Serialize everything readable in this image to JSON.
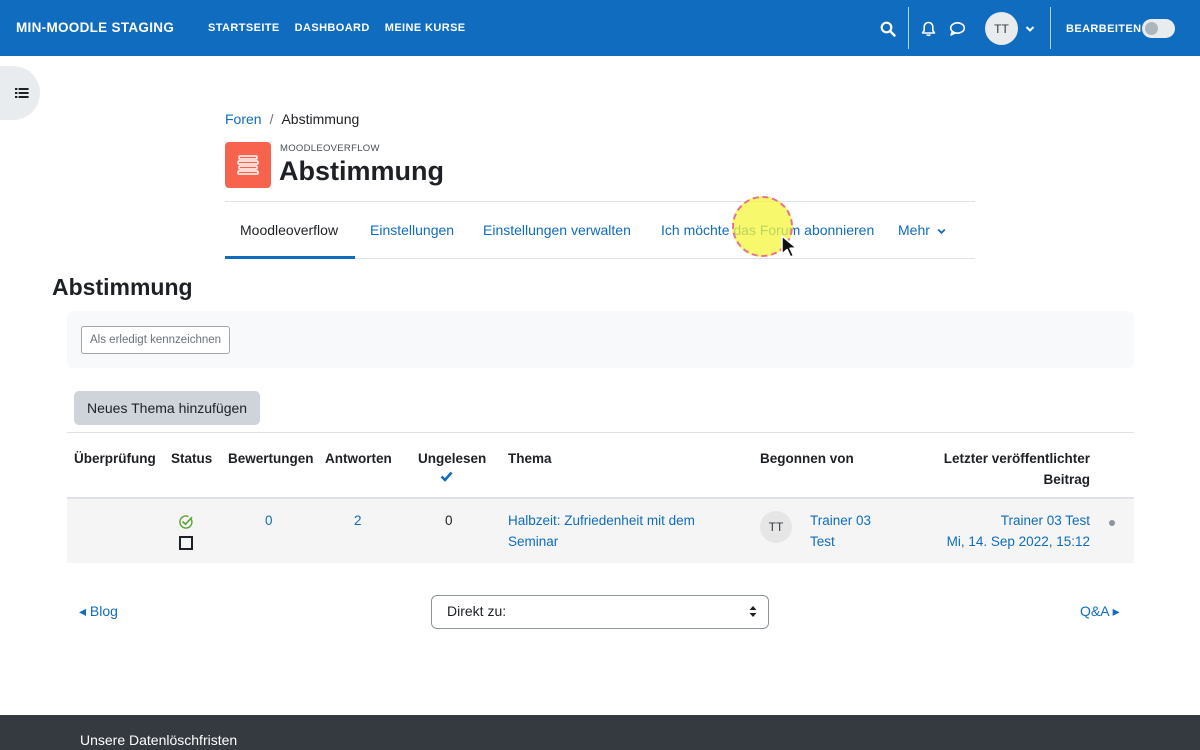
{
  "navbar": {
    "brand": "MIN-MOODLE STAGING",
    "links": [
      "STARTSEITE",
      "DASHBOARD",
      "MEINE KURSE"
    ],
    "avatar_initials": "TT",
    "edit_mode_label": "BEARBEITEN",
    "edit_mode_on": false,
    "icons": [
      "search-icon",
      "bell-icon",
      "chat-icon",
      "chevron-down-icon"
    ]
  },
  "breadcrumb": {
    "parent": "Foren",
    "separator": "/",
    "current": "Abstimmung"
  },
  "header": {
    "module_type": "MOODLEOVERFLOW",
    "title": "Abstimmung",
    "icon": "moodleoverflow-icon",
    "icon_color": "#f7634d"
  },
  "secondary_nav": {
    "tabs": [
      "Moodleoverflow",
      "Einstellungen",
      "Einstellungen verwalten",
      "Ich möchte das Forum abonnieren"
    ],
    "more_label": "Mehr",
    "active_tab": "Moodleoverflow"
  },
  "main": {
    "heading": "Abstimmung",
    "completion_button": "Als erledigt kennzeichnen",
    "new_topic_button": "Neues Thema hinzufügen"
  },
  "table": {
    "headers": {
      "review": "Überprüfung",
      "status": "Status",
      "ratings": "Bewertungen",
      "replies": "Antworten",
      "unread": "Ungelesen",
      "topic": "Thema",
      "started_by": "Begonnen von",
      "last_post_line1": "Letzter veröffentlichter",
      "last_post_line2": "Beitrag"
    },
    "rows": [
      {
        "ratings": "0",
        "replies": "2",
        "unread": "0",
        "topic_line1": "Halbzeit: Zufriedenheit mit dem",
        "topic_line2": "Seminar",
        "author_initials": "TT",
        "author_line1": "Trainer 03",
        "author_line2": "Test",
        "last_post_author": "Trainer 03 Test",
        "last_post_date": "Mi, 14. Sep 2022, 15:12"
      }
    ]
  },
  "activity_nav": {
    "prev": "◂ Blog",
    "jump_placeholder": "Direkt zu:",
    "next": "Q&A ▸"
  },
  "footer": {
    "link": "Unsere Datenlöschfristen"
  },
  "colors": {
    "primary": "#0f6cbf",
    "footer": "#343a40"
  }
}
